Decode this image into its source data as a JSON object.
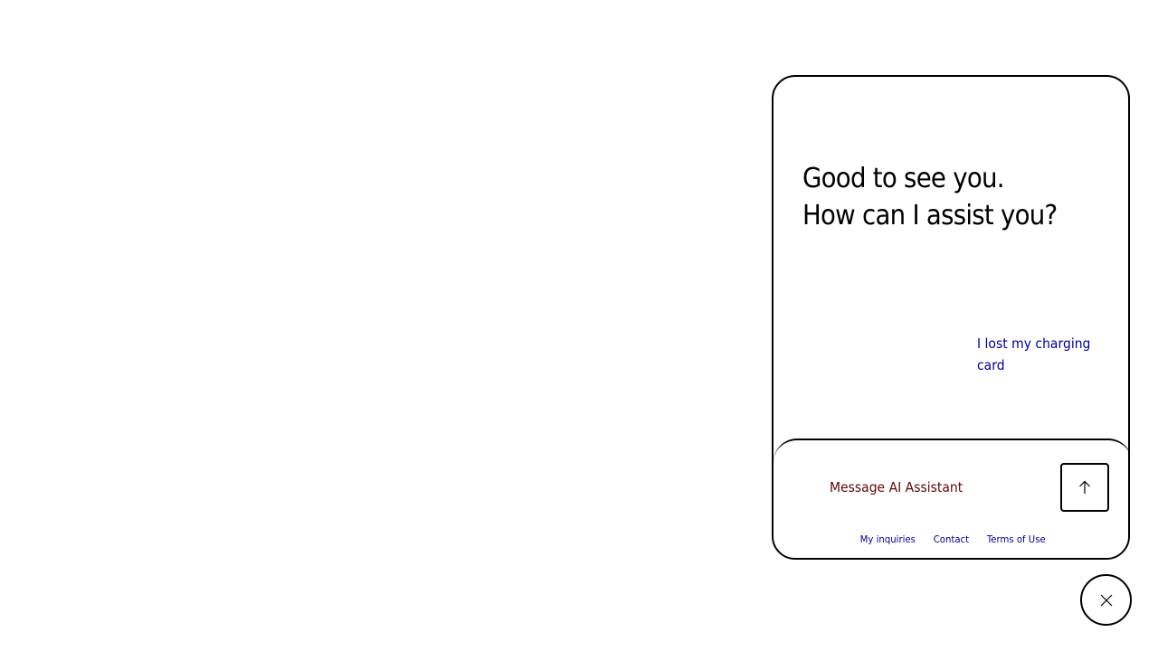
{
  "chat": {
    "greeting_line1": "Good to see you.",
    "greeting_line2": "How can I assist you?",
    "suggestion": "I lost my charging card",
    "input_placeholder": "Message AI Assistant",
    "send_icon": "arrow-up-icon"
  },
  "footer": {
    "links": [
      "My inquiries",
      "Contact",
      "Terms of Use"
    ]
  },
  "close": {
    "icon": "close-icon"
  },
  "colors": {
    "link": "#00008b",
    "placeholder": "#5c0a0a",
    "border": "#000000"
  }
}
